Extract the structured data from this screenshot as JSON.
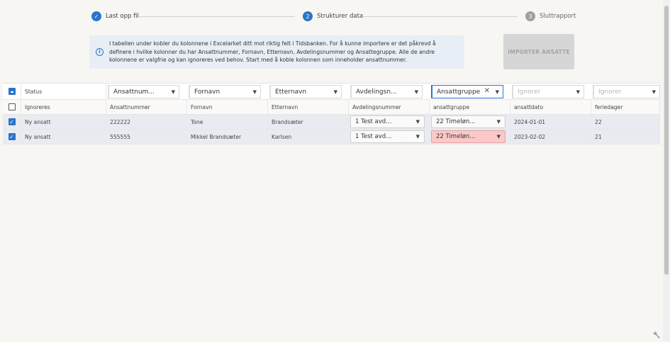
{
  "stepper": {
    "steps": [
      {
        "label": "Last opp fil",
        "num": "✓"
      },
      {
        "label": "Strukturer data",
        "num": "2"
      },
      {
        "label": "Sluttrapport",
        "num": "3"
      }
    ]
  },
  "info": {
    "icon": "info-icon",
    "text": "I tabellen under kobler du kolonnene i Excelarket ditt mot riktig felt i Tidsbanken. For å kunne importere er det påkrevd å definere i hvilke kolonner du har Ansattnummer, Fornavn, Etternavn, Avdelingsnummer og Ansattegruppe. Alle de andre kolonnene er valgfrie og kan ignoreres ved behov. Start med å koble kolonnen som inneholder ansattnummer."
  },
  "import_button": {
    "label": "IMPORTER ANSATTE"
  },
  "columns": {
    "status_header": "Status",
    "selects": [
      "Ansattnum...",
      "Fornavn",
      "Etternavn",
      "Avdelingsn...",
      "Ansattgruppe",
      "Ignorer",
      "Ignorer"
    ]
  },
  "subheader": {
    "values": [
      "Ignoreres",
      "Ansattnummer",
      "Fornavn",
      "Etternavn",
      "Avdelingsnummer",
      "ansattgruppe",
      "ansattdato",
      "feriedager"
    ]
  },
  "rows": [
    {
      "status": "Ny ansatt",
      "ansattnummer": "222222",
      "fornavn": "Tone",
      "etternavn": "Brandsæter",
      "avdeling": "1 Test avd...",
      "gruppe": "22 Timeløn...",
      "ansattdato": "2024-01-01",
      "feriedager": "22"
    },
    {
      "status": "Ny ansatt",
      "ansattnummer": "555555",
      "fornavn": "Mikkel Brandsæter",
      "etternavn": "Karlsen",
      "avdeling": "1 Test avd...",
      "gruppe": "22 Timeløn...",
      "ansattdato": "2023-02-02",
      "feriedager": "21"
    }
  ],
  "colors": {
    "accent": "#2b74c9",
    "error_fill": "#f9c9c9",
    "row_selected": "#e8ecf1"
  }
}
